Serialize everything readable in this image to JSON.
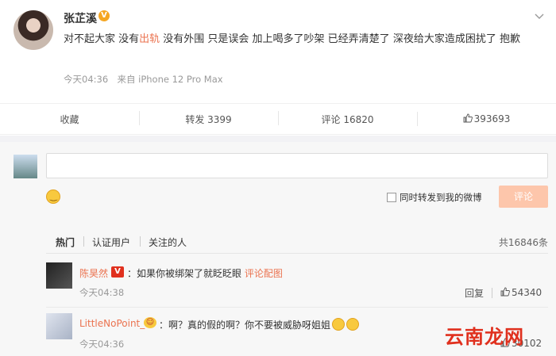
{
  "post": {
    "username": "张芷溪",
    "verified_badge": "V",
    "content_part1": "对不起大家 没有",
    "content_highlight": "出轨",
    "content_part2": " 没有外围 只是误会 加上喝多了吵架 已经弄清楚了 深夜给大家造成困扰了 抱歉",
    "time": "今天04:36",
    "source": "来自 iPhone 12 Pro Max"
  },
  "actions": {
    "favorite": "收藏",
    "repost": "转发 3399",
    "comment": "评论 16820",
    "like_count": "393693"
  },
  "composer": {
    "placeholder": "",
    "repost_checkbox_label": "同时转发到我的微博",
    "submit_label": "评论"
  },
  "comment_tabs": {
    "hot": "热门",
    "verified": "认证用户",
    "following": "关注的人",
    "total": "共16846条"
  },
  "comments": [
    {
      "name": "陈昊然",
      "badge": "V",
      "text": "：如果你被绑架了就眨眨眼",
      "link": "评论配图",
      "time": "今天04:38",
      "reply": "回复",
      "likes": "54340"
    },
    {
      "name": "LittleNoPoint_",
      "badge": "😍",
      "text": "：啊？真的假的啊？你不要被威胁呀姐姐",
      "time": "今天04:36",
      "reply": "回复",
      "likes": "30102"
    }
  ],
  "watermark": {
    "text": "云南龙网"
  },
  "colors": {
    "accent": "#eb7350",
    "verified": "#f5a623",
    "submit": "#fdc6ab"
  }
}
